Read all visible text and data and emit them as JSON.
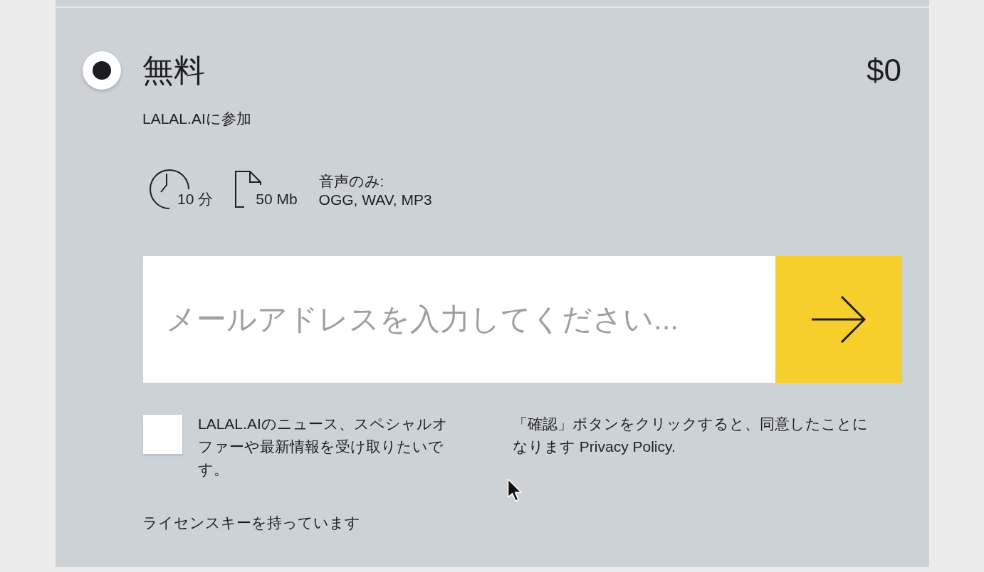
{
  "plan": {
    "name": "無料",
    "selected": true,
    "price": "$0",
    "subtitle": "LALAL.AIに参加",
    "features": [
      {
        "kind": "duration",
        "text": "10 分"
      },
      {
        "kind": "size",
        "text": "50 Mb"
      },
      {
        "kind": "formats",
        "label": "音声のみ:",
        "text": "OGG, WAV, MP3"
      }
    ]
  },
  "email": {
    "placeholder": "メールアドレスを入力してください..."
  },
  "newsletter": {
    "checked": false,
    "label": "LALAL.AIのニュース、スペシャルオファーや最新情報を受け取りたいです。"
  },
  "consent": {
    "text": "「確認」ボタンをクリックすると、同意したことになります ",
    "link": "Privacy Policy",
    "end": "."
  },
  "license_link": "ライセンスキーを持っています"
}
